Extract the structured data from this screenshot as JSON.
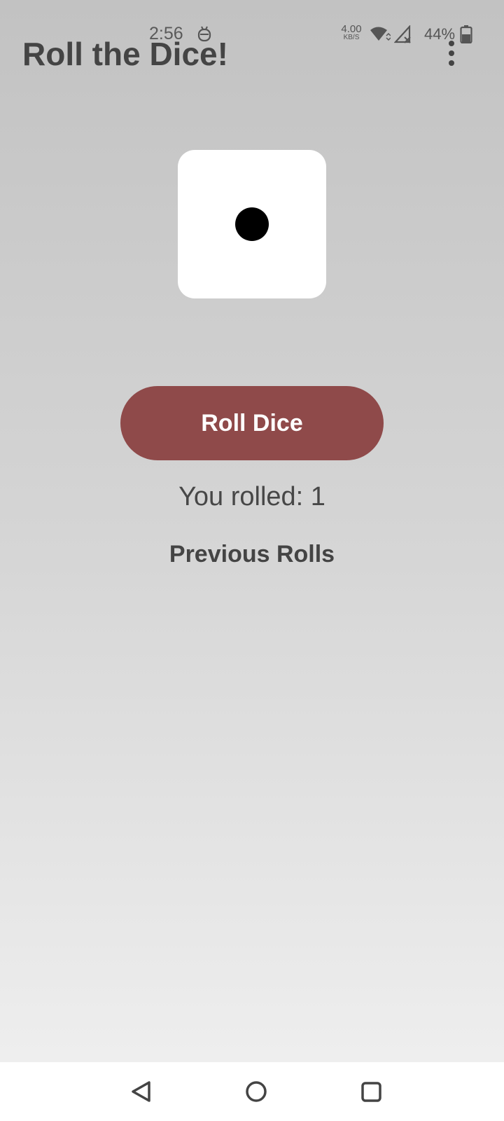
{
  "status_bar": {
    "time": "2:56",
    "net_speed_value": "4.00",
    "net_speed_unit": "KB/S",
    "battery_percent": "44%",
    "notification_icon": "android-face-icon",
    "wifi_icon": "wifi-icon",
    "signal_icon": "signal-no-service-icon",
    "battery_icon": "battery-icon"
  },
  "app_bar": {
    "title": "Roll the Dice!",
    "menu_icon": "more-vert-icon"
  },
  "dice": {
    "face_value": 1,
    "face_color": "#ffffff",
    "pip_color": "#000000"
  },
  "roll_button": {
    "label": "Roll Dice",
    "color": "#8f4a4a"
  },
  "result": {
    "text": "You rolled: 1"
  },
  "history": {
    "title": "Previous Rolls",
    "items": []
  },
  "navigation": {
    "back_icon": "back-triangle-icon",
    "home_icon": "home-circle-icon",
    "recents_icon": "recents-square-icon"
  },
  "colors": {
    "background_top": "#c2c2c2",
    "background_bottom": "#f1f1f1",
    "text": "#444444"
  }
}
